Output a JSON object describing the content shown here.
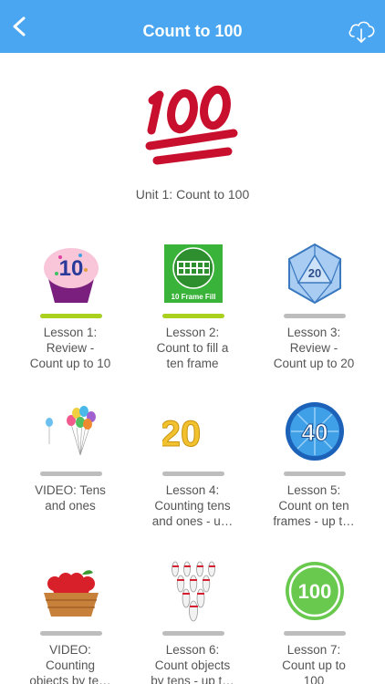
{
  "nav": {
    "title": "Count to 100"
  },
  "unit_title": "Unit 1: Count to 100",
  "thumb_texts": {
    "l1": "10",
    "l2_caption": "10 Frame Fill",
    "l3": "20",
    "l4": "20",
    "l5": "40",
    "l7": "100"
  },
  "lessons": [
    {
      "line1": "Lesson 1:",
      "line2": "Review -",
      "line3": "Count up to 10",
      "progress": 1.0
    },
    {
      "line1": "Lesson 2:",
      "line2": "Count to fill a",
      "line3": "ten frame",
      "progress": 1.0
    },
    {
      "line1": "Lesson 3:",
      "line2": "Review -",
      "line3": "Count up to 20",
      "progress": 0
    },
    {
      "line1": "VIDEO: Tens",
      "line2": "and ones",
      "line3": "",
      "progress": 0
    },
    {
      "line1": "Lesson 4:",
      "line2": "Counting tens",
      "line3": "and ones - u…",
      "progress": 0
    },
    {
      "line1": "Lesson 5:",
      "line2": "Count on ten",
      "line3": "frames - up t…",
      "progress": 0
    },
    {
      "line1": "VIDEO:",
      "line2": "Counting",
      "line3": "objects by te…",
      "progress": 0
    },
    {
      "line1": "Lesson 6:",
      "line2": "Count objects",
      "line3": "by tens - up t…",
      "progress": 0
    },
    {
      "line1": "Lesson 7:",
      "line2": "Count up to",
      "line3": "100",
      "progress": 0
    }
  ],
  "colors": {
    "nav_bg": "#4aa6f0",
    "progress_done": "#a9d11d",
    "progress_empty": "#bdbdbd",
    "hundred_red": "#c8102e"
  }
}
